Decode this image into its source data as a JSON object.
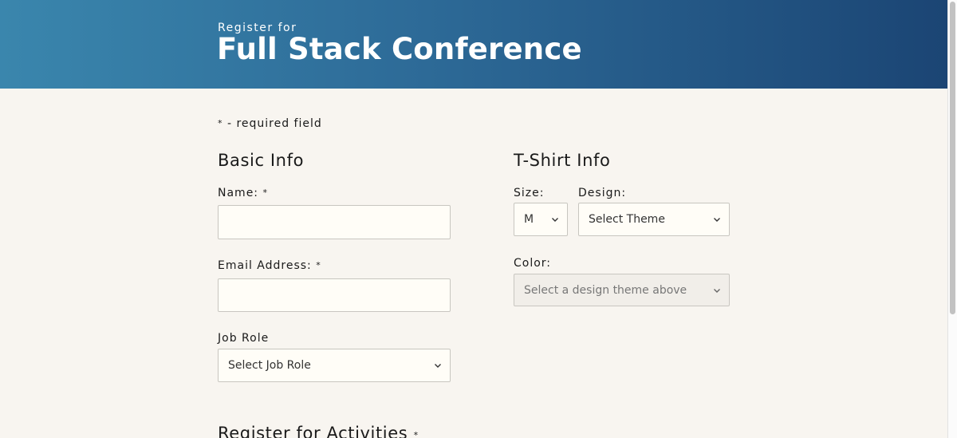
{
  "header": {
    "pre_title": "Register for",
    "title": "Full Stack Conference"
  },
  "required_note": {
    "star": "*",
    "text": " - required field"
  },
  "basic_info": {
    "title": "Basic Info",
    "name_label": "Name:",
    "name_value": "",
    "email_label": "Email Address:",
    "email_value": "",
    "job_role_label": "Job Role",
    "job_role_selected": "Select Job Role"
  },
  "tshirt_info": {
    "title": "T-Shirt Info",
    "size_label": "Size:",
    "size_selected": "M",
    "design_label": "Design:",
    "design_selected": "Select Theme",
    "color_label": "Color:",
    "color_selected": "Select a design theme above"
  },
  "activities": {
    "title": "Register for Activities"
  },
  "required_star": "*",
  "icons": {
    "dropdown": "chevron-down-icon"
  }
}
